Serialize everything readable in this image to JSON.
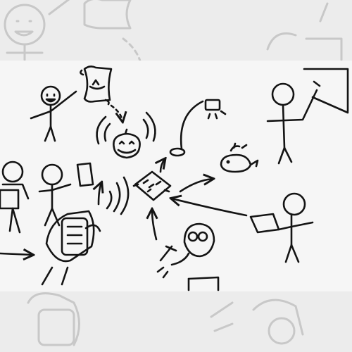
{
  "image": {
    "kind": "hand-drawn doodle illustration (black marker on white paper) with a faded blurred copy above and below",
    "paper_color": "#f6f6f6",
    "backdrop_color": "#ececec",
    "ink_color": "#141414",
    "faded_ink_color": "#c8c8c8",
    "elements": [
      "stick-figure-holding-scroll",
      "scroll-with-boat-sketch",
      "jack-o-lantern-with-signal-waves",
      "desk-lamp",
      "stick-figure-at-whiteboard",
      "whale-with-spout",
      "circuit-board",
      "stick-figures-on-left",
      "figure-holding-phone",
      "stick-figure-with-laptop",
      "person-with-glasses-and-hammer"
    ]
  }
}
